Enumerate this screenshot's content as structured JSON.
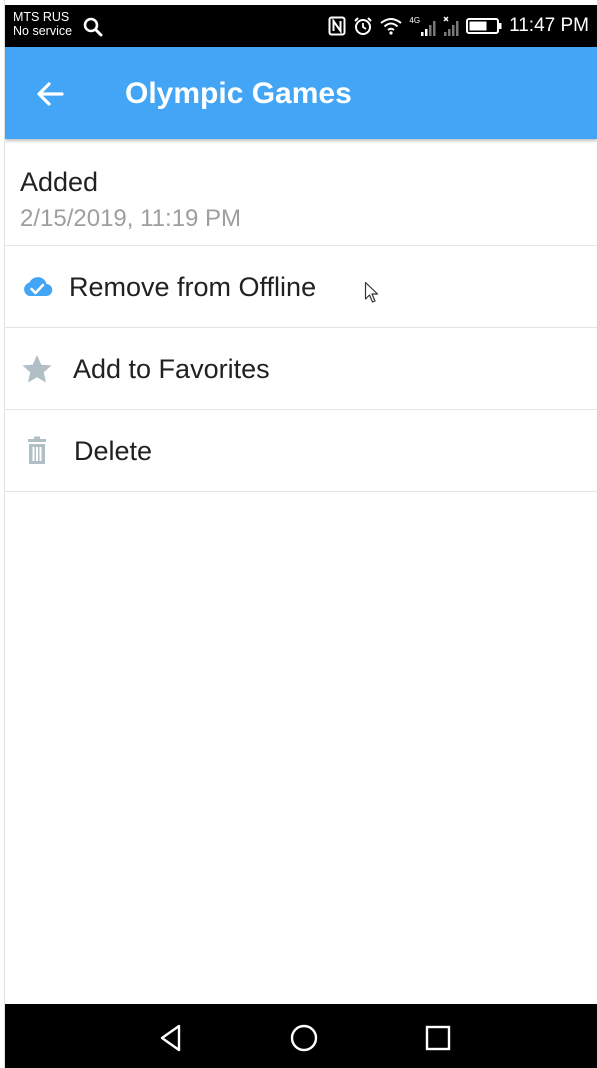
{
  "status_bar": {
    "carrier_name": "MTS RUS",
    "carrier_status": "No service",
    "network_type": "4G",
    "time": "11:47 PM",
    "icons": [
      "search-icon",
      "nfc-icon",
      "alarm-icon",
      "wifi-icon",
      "signal-icon",
      "signal-off-icon",
      "battery-icon"
    ]
  },
  "app_bar": {
    "title": "Olympic Games",
    "background_color": "#42a5f5",
    "back_icon": "arrow-left-icon"
  },
  "details": {
    "label": "Added",
    "date": "2/15/2019, 11:19 PM"
  },
  "menu": {
    "items": [
      {
        "label": "Remove from Offline",
        "icon": "cloud-check-icon",
        "icon_color": "#42a5f5"
      },
      {
        "label": "Add to Favorites",
        "icon": "star-icon",
        "icon_color": "#b0bec5"
      },
      {
        "label": "Delete",
        "icon": "trash-icon",
        "icon_color": "#b0bec5"
      }
    ]
  },
  "nav_bar": {
    "buttons": [
      "back-triangle-icon",
      "home-circle-icon",
      "recents-square-icon"
    ]
  }
}
